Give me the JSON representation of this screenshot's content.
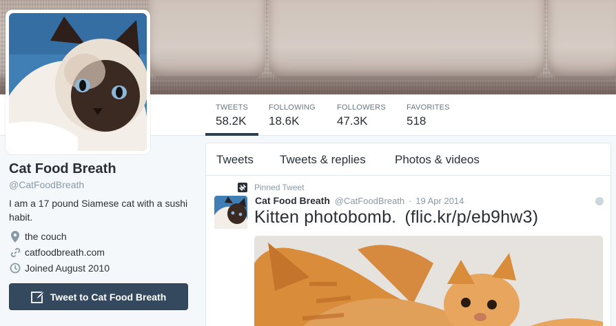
{
  "profile": {
    "name": "Cat Food Breath",
    "handle": "@CatFoodBreath",
    "bio": "I am a 17 pound Siamese cat with a sushi habit.",
    "location": "the couch",
    "website": "catfoodbreath.com",
    "joined": "Joined August 2010",
    "tweet_to_label": "Tweet to Cat Food Breath"
  },
  "nav": {
    "stats": [
      {
        "label": "TWEETS",
        "value": "58.2K"
      },
      {
        "label": "FOLLOWING",
        "value": "18.6K"
      },
      {
        "label": "FOLLOWERS",
        "value": "47.3K"
      },
      {
        "label": "FAVORITES",
        "value": "518"
      }
    ]
  },
  "timeline": {
    "tabs": [
      "Tweets",
      "Tweets & replies",
      "Photos & videos"
    ],
    "pinned_label": "Pinned Tweet",
    "tweet": {
      "name": "Cat Food Breath",
      "handle": "@CatFoodBreath",
      "dot": "·",
      "time": "19 Apr 2014",
      "text": "Kitten photobomb.",
      "link": "(flic.kr/p/eb9hw3)"
    }
  },
  "colors": {
    "accent": "#2c3e50",
    "button": "#34495e",
    "muted": "#8899a6",
    "text": "#292f33"
  }
}
